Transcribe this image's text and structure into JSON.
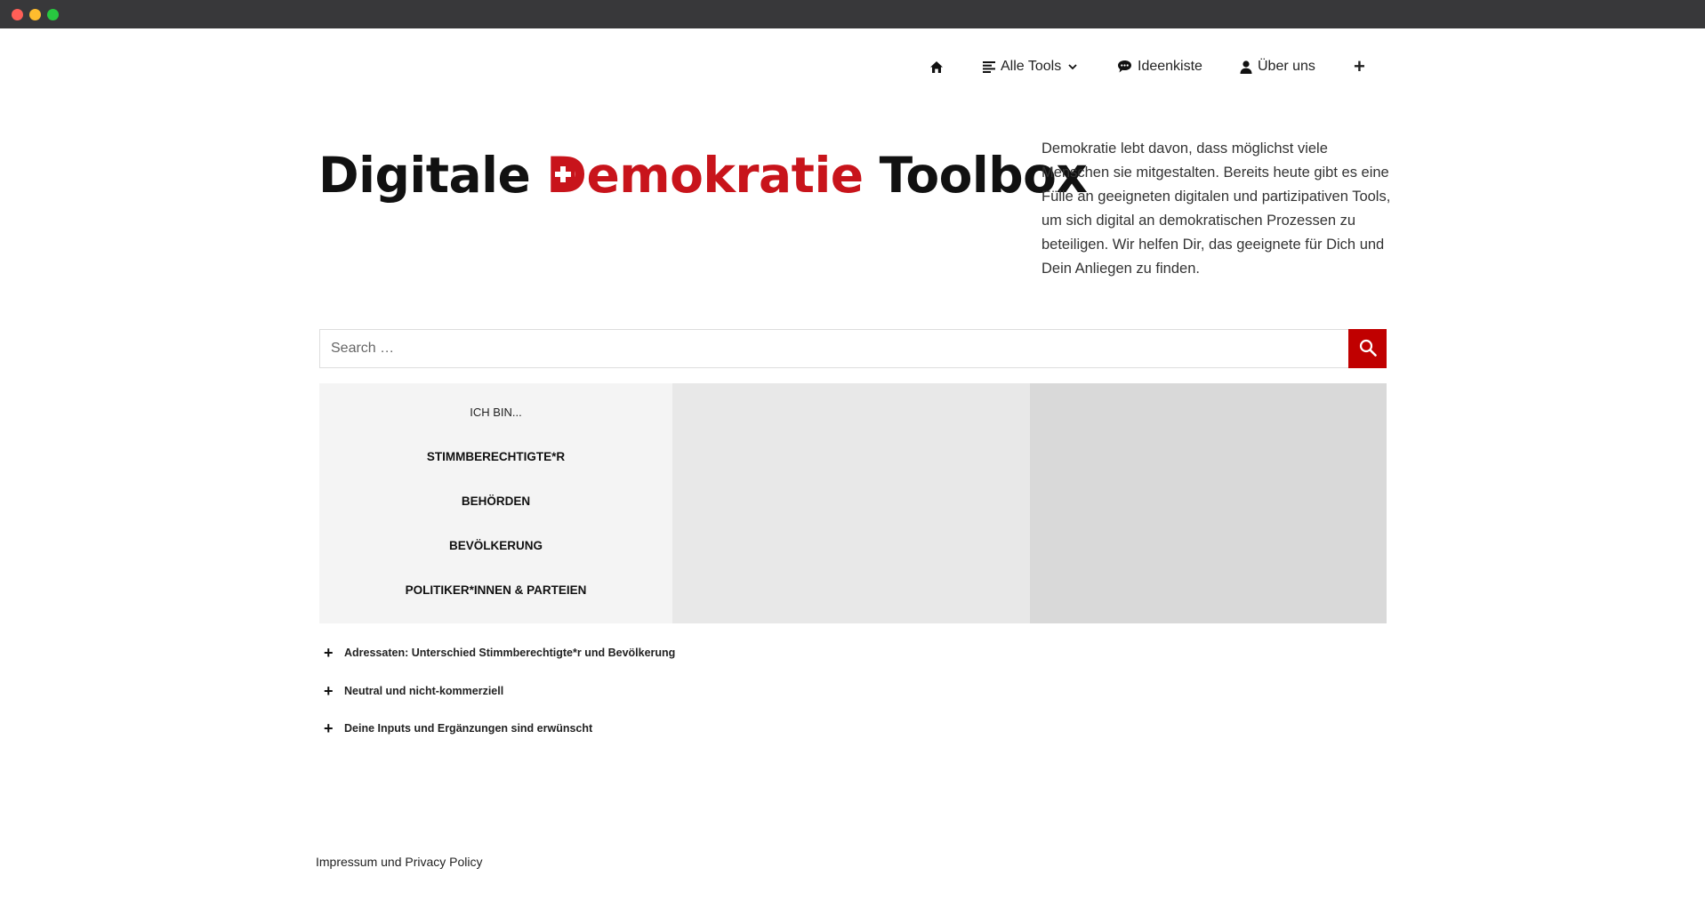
{
  "nav": {
    "home_icon": "home-icon",
    "alle_tools": "Alle Tools",
    "ideenkiste": "Ideenkiste",
    "ueber_uns": "Über uns",
    "plus": "+"
  },
  "logo": {
    "part1": "Digitale",
    "part2": "emokratie",
    "part3": "Toolbox",
    "accent_color": "#c8141b"
  },
  "intro": "Demokratie lebt davon, dass möglichst viele Menschen sie mitgestalten. Bereits heute gibt es eine Fülle an geeigneten digitalen und partizipativen Tools, um sich digital an demokratischen Prozessen zu beteiligen. Wir helfen Dir, das geeignete für Dich und Dein Anliegen zu finden.",
  "search": {
    "placeholder": "Search …",
    "value": "",
    "button_color": "#c00000"
  },
  "audience": {
    "heading": "ICH BIN...",
    "items": [
      "STIMMBERECHTIGTE*R",
      "BEHÖRDEN",
      "BEVÖLKERUNG",
      "POLITIKER*INNEN & PARTEIEN"
    ]
  },
  "accordion": [
    "Adressaten: Unterschied Stimmberechtigte*r und Bevölkerung",
    "Neutral und nicht-kommerziell",
    "Deine Inputs und Ergänzungen sind erwünscht"
  ],
  "footer": "Impressum und Privacy Policy"
}
